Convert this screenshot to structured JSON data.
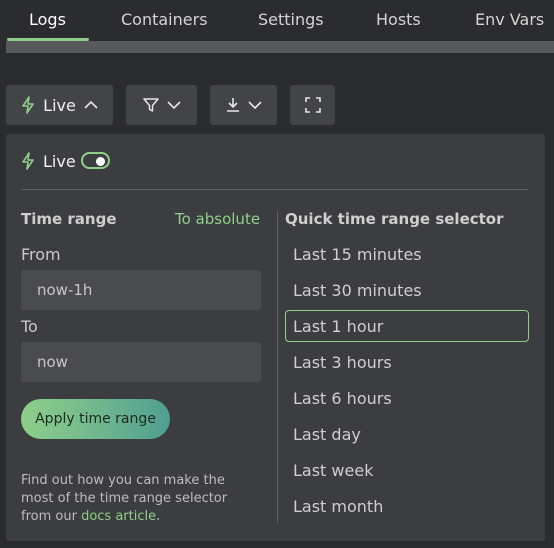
{
  "tabs": [
    {
      "label": "Logs",
      "active": true
    },
    {
      "label": "Containers",
      "active": false
    },
    {
      "label": "Settings",
      "active": false
    },
    {
      "label": "Hosts",
      "active": false
    },
    {
      "label": "Env Vars",
      "active": false
    }
  ],
  "toolbar": {
    "live_label": "Live",
    "icons": [
      "bolt-icon",
      "chevron-up-icon",
      "filter-icon",
      "chevron-down-icon",
      "download-icon",
      "chevron-down-icon",
      "fullscreen-icon"
    ]
  },
  "panel": {
    "live_label": "Live",
    "live_enabled": true,
    "time_range": {
      "title": "Time range",
      "to_absolute": "To absolute",
      "from_label": "From",
      "from_value": "now-1h",
      "to_label": "To",
      "to_value": "now",
      "apply_label": "Apply time range",
      "help_text": "Find out how you can make the most of the time range selector from our ",
      "help_link": "docs article",
      "help_end": "."
    },
    "quick": {
      "title": "Quick time range selector",
      "items": [
        "Last 15 minutes",
        "Last 30 minutes",
        "Last 1 hour",
        "Last 3 hours",
        "Last 6 hours",
        "Last day",
        "Last week",
        "Last month"
      ],
      "selected": "Last 1 hour"
    }
  },
  "colors": {
    "accent": "#8ecf89",
    "background": "#2b2c2f",
    "panel": "#3c3d40",
    "button": "#434447"
  }
}
